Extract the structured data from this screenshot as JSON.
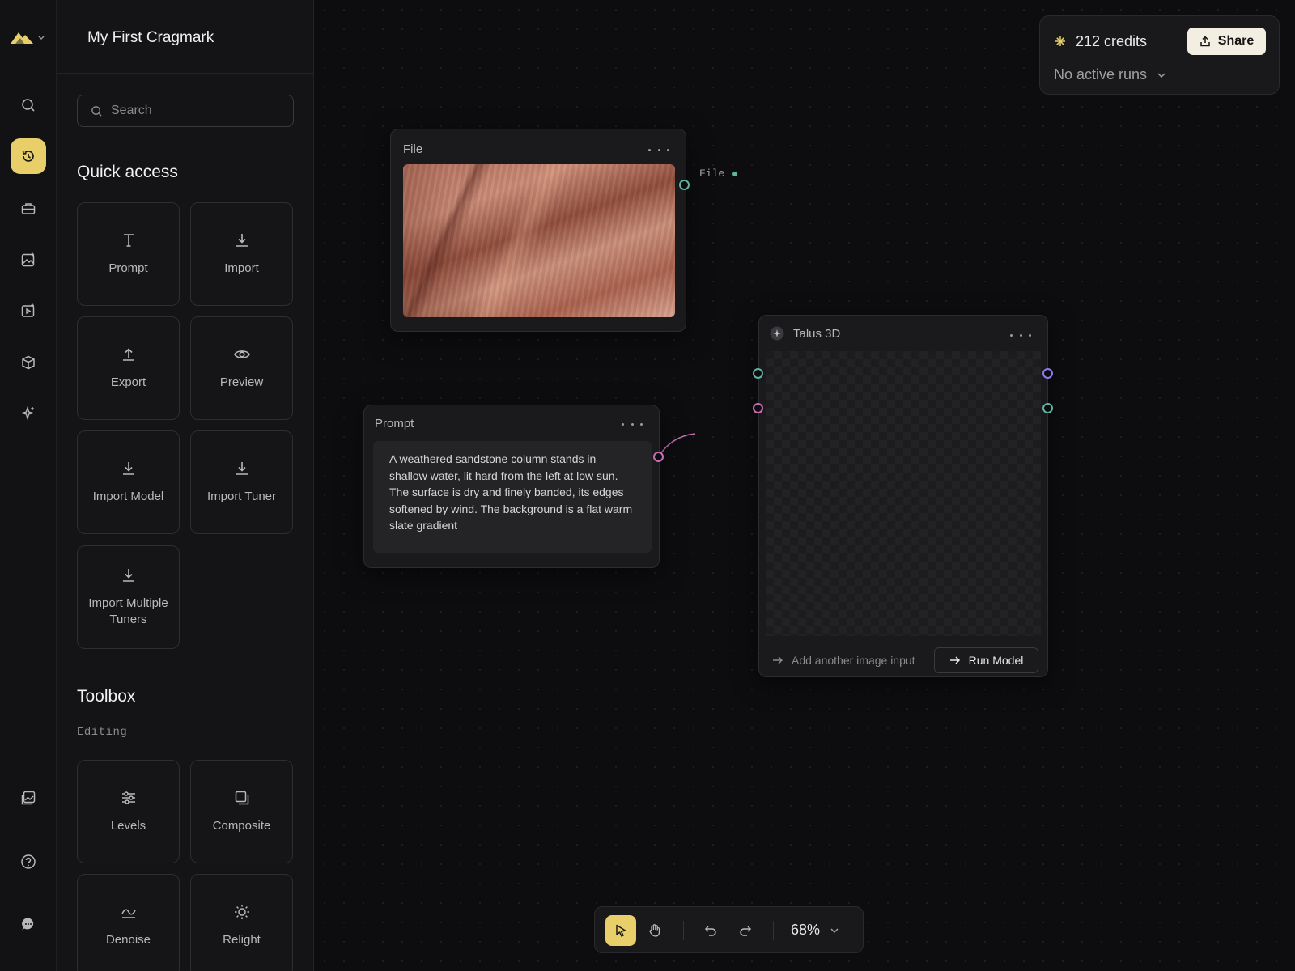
{
  "project": {
    "title": "My First Cragmark"
  },
  "rail": {
    "items": [
      "search-icon",
      "history-icon",
      "briefcase-icon",
      "image-generate-icon",
      "video-generate-icon",
      "cube-icon",
      "sparkles-icon"
    ],
    "bottom_items": [
      "gallery-icon",
      "help-icon",
      "chat-icon"
    ],
    "active": "history-icon"
  },
  "search": {
    "placeholder": "Search"
  },
  "quick_access": {
    "heading": "Quick access",
    "items": [
      {
        "label": "Prompt",
        "icon": "text-icon"
      },
      {
        "label": "Import",
        "icon": "download-icon"
      },
      {
        "label": "Export",
        "icon": "upload-icon"
      },
      {
        "label": "Preview",
        "icon": "eye-icon"
      },
      {
        "label": "Import Model",
        "icon": "download-icon"
      },
      {
        "label": "Import Tuner",
        "icon": "download-icon"
      },
      {
        "label": "Import Multiple Tuners",
        "icon": "download-icon"
      }
    ]
  },
  "toolbox": {
    "heading": "Toolbox",
    "subheading": "Editing",
    "items": [
      {
        "label": "Levels",
        "icon": "sliders-icon"
      },
      {
        "label": "Composite",
        "icon": "layers-icon"
      },
      {
        "label": "Denoise",
        "icon": "wave-icon"
      },
      {
        "label": "Relight",
        "icon": "sun-icon"
      }
    ]
  },
  "nodes": {
    "file": {
      "title": "File",
      "output_label": "File"
    },
    "prompt": {
      "title": "Prompt",
      "text": "A weathered sandstone column stands in shallow water, lit hard from the left at low sun. The surface is dry and finely banded, its edges softened by wind. The background is a flat warm slate gradient"
    },
    "talus": {
      "title": "Talus 3D",
      "add_input_label": "Add another image input",
      "run_label": "Run Model"
    }
  },
  "credits": {
    "amount": "212 credits",
    "share_label": "Share",
    "runs_label": "No active runs"
  },
  "toolbar": {
    "zoom": "68%",
    "active_tool": "select"
  },
  "colors": {
    "accent": "#e8cf6a",
    "port_teal": "#5fb3a0",
    "port_pink": "#c76fb6",
    "port_purple": "#8c7cf0",
    "background": "#0d0d0f"
  }
}
